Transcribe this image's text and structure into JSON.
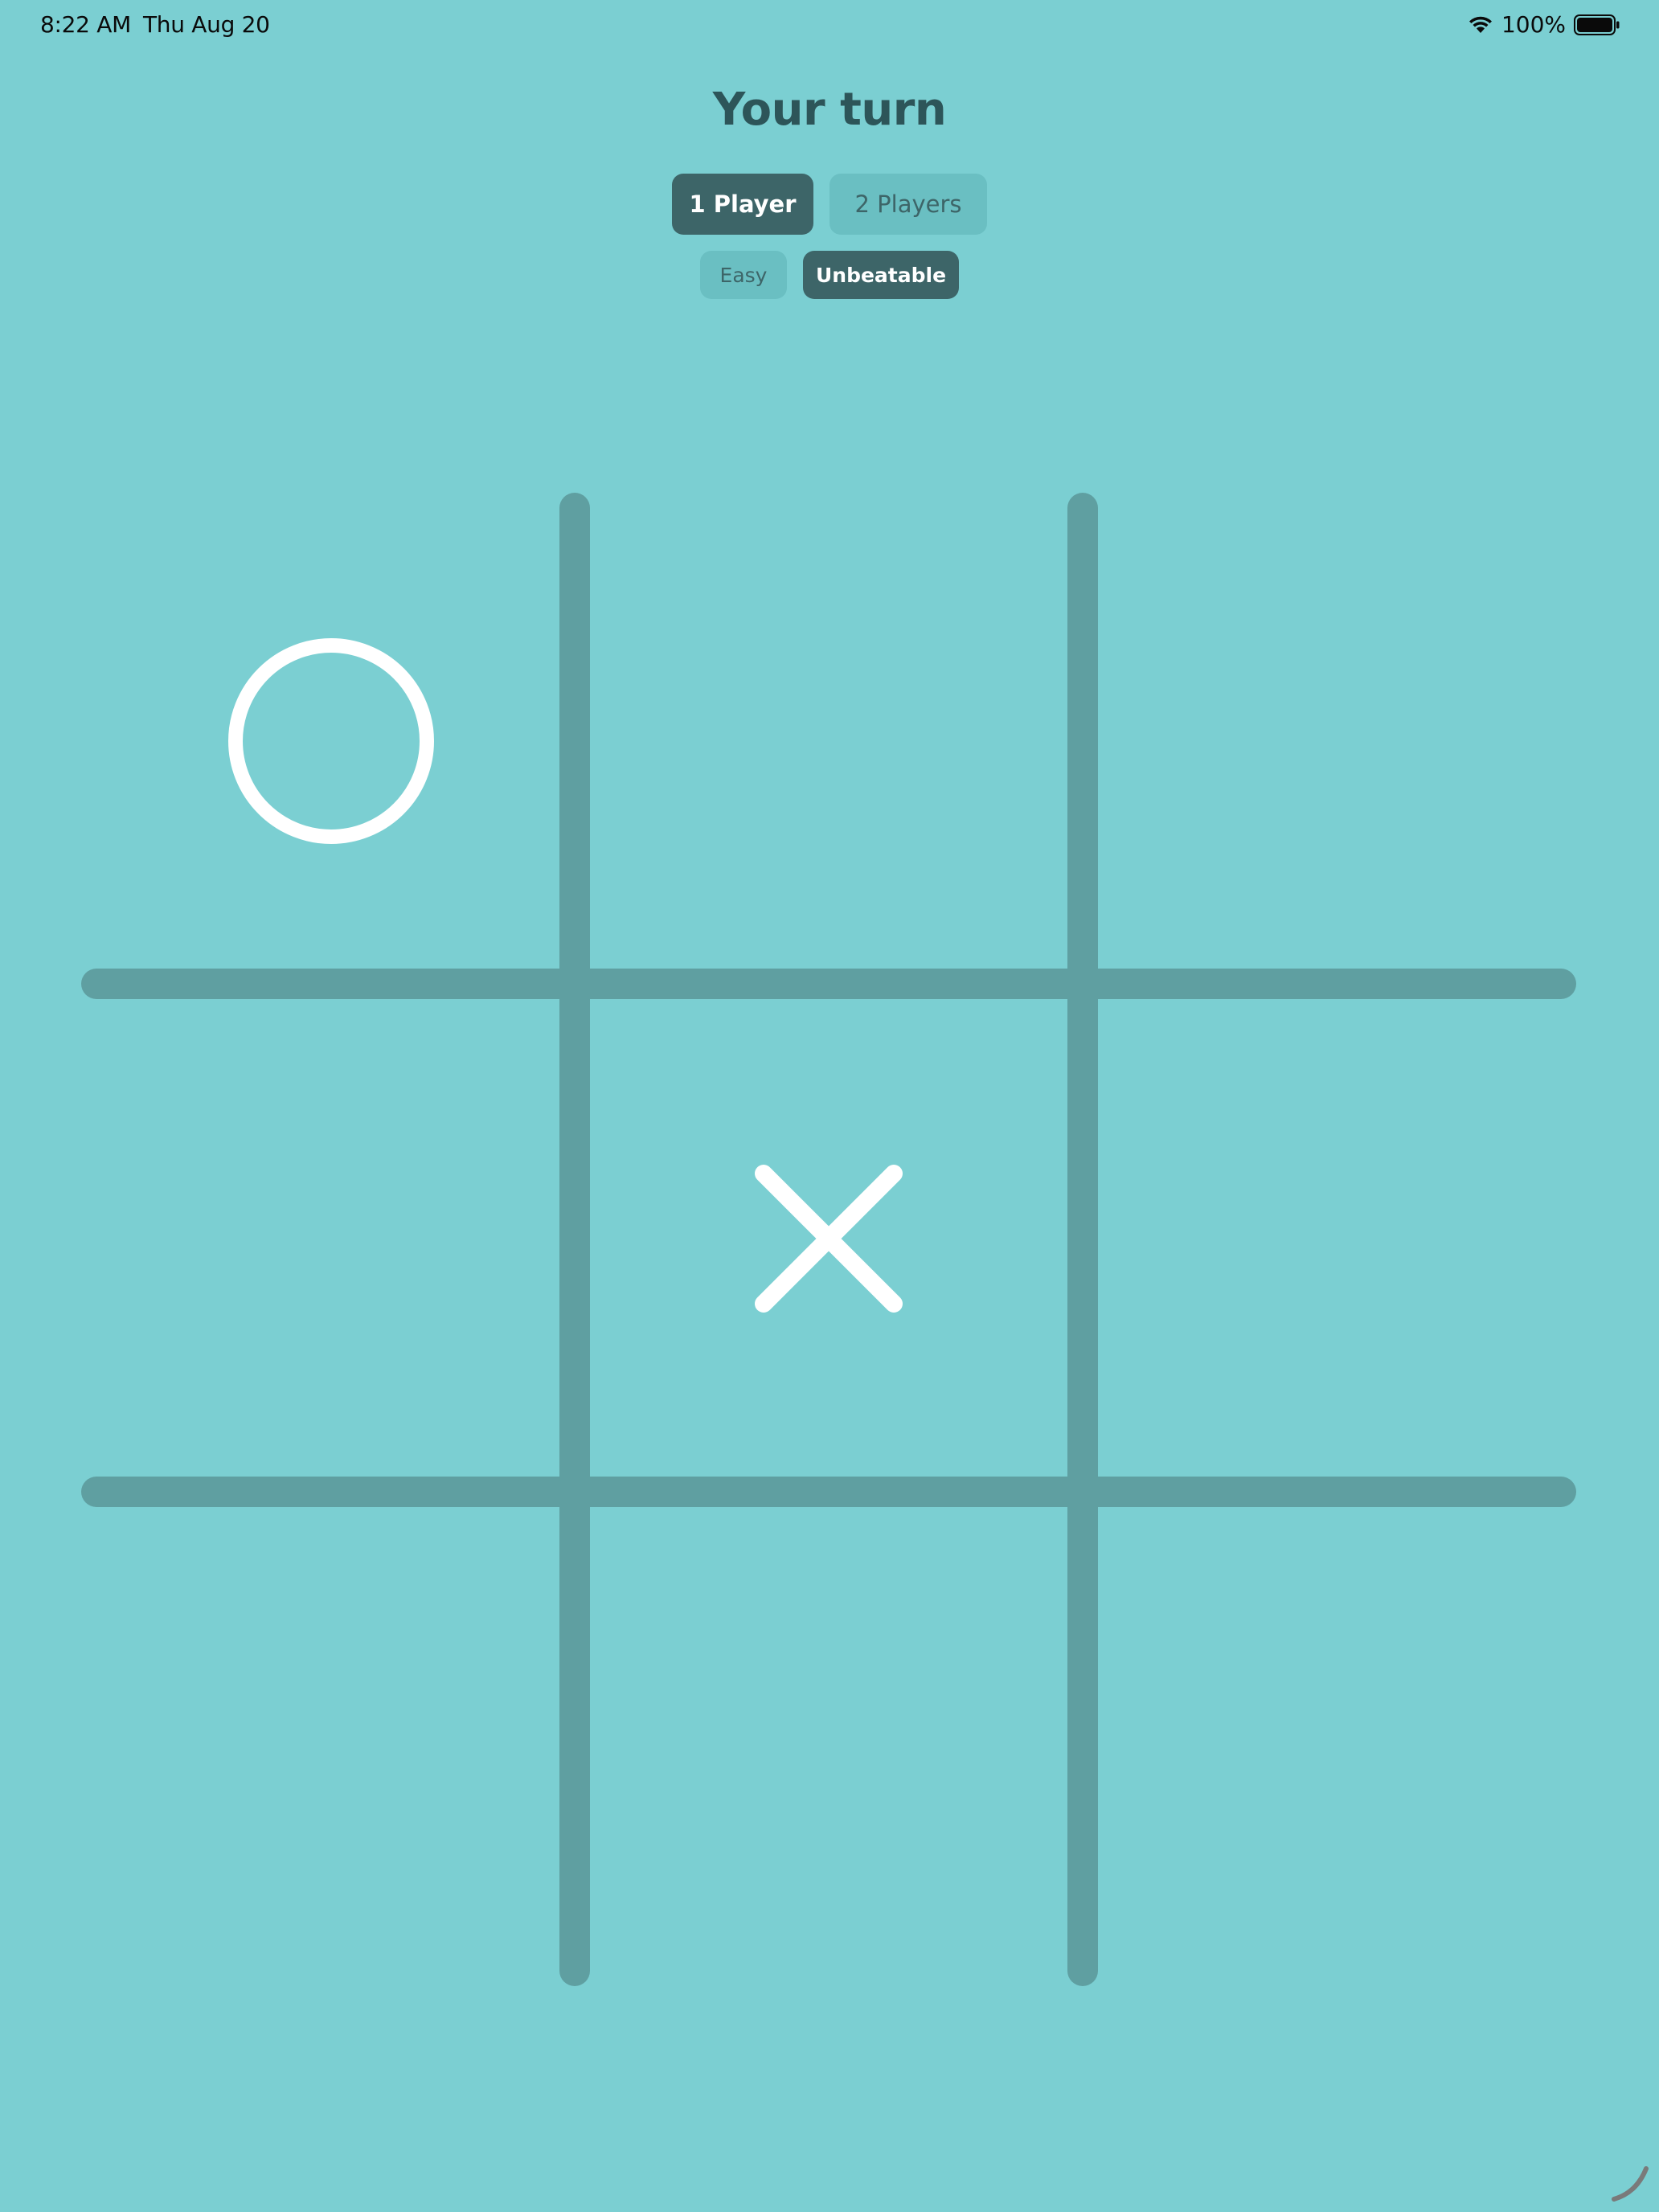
{
  "status_bar": {
    "time": "8:22 AM",
    "date": "Thu Aug 20",
    "battery_text": "100%",
    "icons": [
      "wifi-icon",
      "battery-icon"
    ]
  },
  "title": "Your turn",
  "mode": {
    "options": [
      {
        "label": "1 Player",
        "selected": true
      },
      {
        "label": "2 Players",
        "selected": false
      }
    ]
  },
  "difficulty": {
    "options": [
      {
        "label": "Easy",
        "selected": false
      },
      {
        "label": "Unbeatable",
        "selected": true
      }
    ]
  },
  "board": {
    "cells": [
      "O",
      "",
      "",
      "",
      "X",
      "",
      "",
      "",
      ""
    ]
  },
  "colors": {
    "background": "#7bcfd2",
    "grid_line": "#5f9fa1",
    "mark": "#ffffff",
    "active_button": "#3d6568",
    "inactive_button": "#6abfc2",
    "title_text": "#2d5559"
  }
}
